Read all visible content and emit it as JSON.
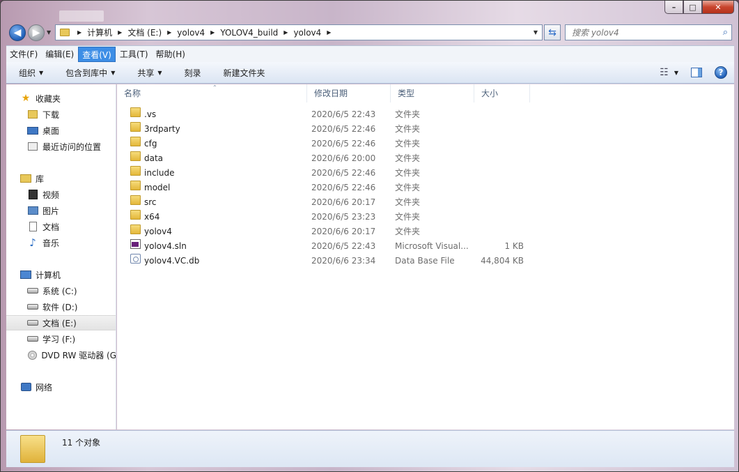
{
  "address": {
    "crumbs": [
      "计算机",
      "文档 (E:)",
      "yolov4",
      "YOLOV4_build",
      "yolov4"
    ]
  },
  "search": {
    "placeholder": "搜索 yolov4"
  },
  "menubar": [
    "文件(F)",
    "编辑(E)",
    "查看(V)",
    "工具(T)",
    "帮助(H)"
  ],
  "toolbar": {
    "organize": "组织",
    "include_library": "包含到库中",
    "share": "共享",
    "burn": "刻录",
    "new_folder": "新建文件夹"
  },
  "nav": {
    "favorites": "收藏夹",
    "downloads": "下载",
    "desktop": "桌面",
    "recent": "最近访问的位置",
    "libraries": "库",
    "videos": "视频",
    "pictures": "图片",
    "documents": "文档",
    "music": "音乐",
    "computer": "计算机",
    "drive_c": "系统 (C:)",
    "drive_d": "软件 (D:)",
    "drive_e": "文档 (E:)",
    "drive_f": "学习 (F:)",
    "dvd": "DVD RW 驱动器 (G",
    "network": "网络"
  },
  "columns": {
    "name": "名称",
    "date": "修改日期",
    "type": "类型",
    "size": "大小"
  },
  "files": [
    {
      "name": ".vs",
      "date": "2020/6/5 22:43",
      "type": "文件夹",
      "size": "",
      "icon": "folder"
    },
    {
      "name": "3rdparty",
      "date": "2020/6/5 22:46",
      "type": "文件夹",
      "size": "",
      "icon": "folder"
    },
    {
      "name": "cfg",
      "date": "2020/6/5 22:46",
      "type": "文件夹",
      "size": "",
      "icon": "folder"
    },
    {
      "name": "data",
      "date": "2020/6/6 20:00",
      "type": "文件夹",
      "size": "",
      "icon": "folder"
    },
    {
      "name": "include",
      "date": "2020/6/5 22:46",
      "type": "文件夹",
      "size": "",
      "icon": "folder"
    },
    {
      "name": "model",
      "date": "2020/6/5 22:46",
      "type": "文件夹",
      "size": "",
      "icon": "folder"
    },
    {
      "name": "src",
      "date": "2020/6/6 20:17",
      "type": "文件夹",
      "size": "",
      "icon": "folder"
    },
    {
      "name": "x64",
      "date": "2020/6/5 23:23",
      "type": "文件夹",
      "size": "",
      "icon": "folder"
    },
    {
      "name": "yolov4",
      "date": "2020/6/6 20:17",
      "type": "文件夹",
      "size": "",
      "icon": "folder"
    },
    {
      "name": "yolov4.sln",
      "date": "2020/6/5 22:43",
      "type": "Microsoft Visual...",
      "size": "1 KB",
      "icon": "sln"
    },
    {
      "name": "yolov4.VC.db",
      "date": "2020/6/6 23:34",
      "type": "Data Base File",
      "size": "44,804 KB",
      "icon": "db"
    }
  ],
  "details": {
    "count": "11 个对象"
  }
}
